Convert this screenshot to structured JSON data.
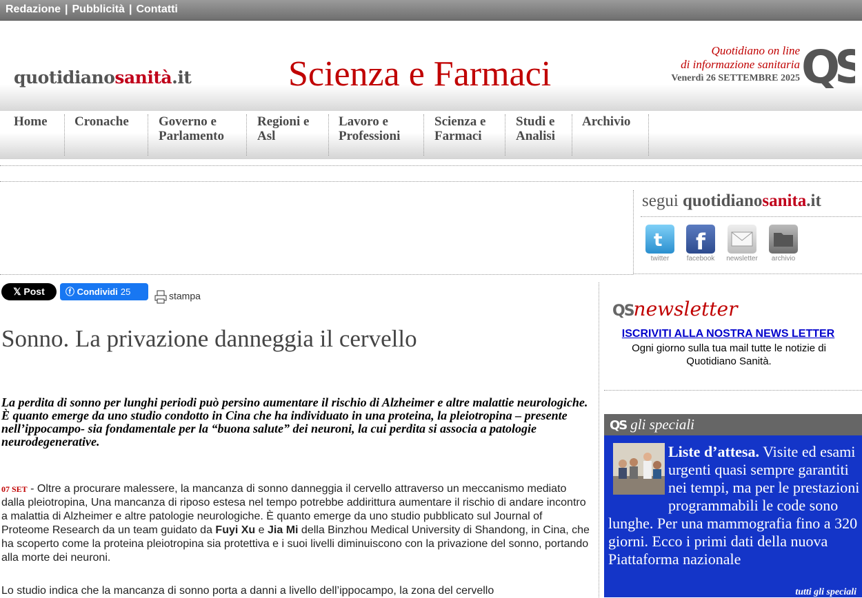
{
  "topbar": {
    "links": [
      "Redazione",
      "Pubblicità",
      "Contatti"
    ],
    "separator": "|"
  },
  "header": {
    "logo_part1": "quotidiano",
    "logo_part2": "sanità",
    "logo_part3": ".it",
    "section_title": "Scienza e Farmaci",
    "tagline_line1": "Quotidiano on line",
    "tagline_line2": "di informazione sanitaria",
    "date": "Venerdì 26 SETTEMBRE 2025",
    "brand_mark": "QS"
  },
  "nav": {
    "items": [
      {
        "line1": "Home",
        "line2": ""
      },
      {
        "line1": "Cronache",
        "line2": ""
      },
      {
        "line1": "Governo e",
        "line2": "Parlamento"
      },
      {
        "line1": "Regioni e",
        "line2": "Asl"
      },
      {
        "line1": "Lavoro e",
        "line2": "Professioni"
      },
      {
        "line1": "Scienza e",
        "line2": "Farmaci"
      },
      {
        "line1": "Studi e",
        "line2": "Analisi"
      },
      {
        "line1": "Archivio",
        "line2": ""
      }
    ]
  },
  "follow": {
    "prefix": "segui ",
    "name1": "quotidiano",
    "name2": "sanita",
    "name3": ".it",
    "channels": [
      {
        "label": "twitter",
        "icon": "twitter-icon",
        "color": "#3aa6e0"
      },
      {
        "label": "facebook",
        "icon": "facebook-icon",
        "color": "#3b5998"
      },
      {
        "label": "newsletter",
        "icon": "envelope-icon",
        "color": "#c8c8c8"
      },
      {
        "label": "archivio",
        "icon": "folder-icon",
        "color": "#8a8a8a"
      }
    ]
  },
  "share": {
    "x_post": "Post",
    "fb_label": "Condividi",
    "fb_count": "25",
    "print_label": "stampa"
  },
  "article": {
    "title": "Sonno. La privazione danneggia il cervello",
    "lead": "La perdita di sonno per lunghi periodi può persino aumentare il rischio di Alzheimer e altre malattie neurologiche. È quanto emerge da uno studio condotto in Cina che ha individuato in una proteina, la pleiotropina – presente nell’ippocampo- sia fondamentale per la “buona salute” dei neuroni, la cui perdita si associa a patologie neurodegenerative.",
    "dateline": "07 SET",
    "p1_a": " - Oltre a procurare malessere, la mancanza di sonno danneggia il cervello attraverso un meccanismo mediato dalla pleiotropina, Una mancanza di riposo estesa nel tempo potrebbe addirittura aumentare il rischio di andare incontro a malattia di Alzheimer e altre patologie neurologiche. È quanto emerge da uno studio pubblicato sul Journal of Proteome Research da un team guidato da ",
    "author1": "Fuyi Xu",
    "p1_b": " e ",
    "author2": "Jia Mi",
    "p1_c": " della Binzhou Medical University di Shandong, in Cina, che ha scoperto come la proteina pleiotropina sia protettiva e i suoi livelli diminuiscono con la privazione del sonno, portando alla morte dei neuroni.",
    "p2": "Lo studio indica che la mancanza di sonno porta a danni a livello dell’ippocampo, la zona del cervello"
  },
  "newsletter": {
    "brand": "QS",
    "title": "newsletter",
    "link": "ISCRIVITI ALLA NOSTRA NEWS LETTER",
    "desc": "Ogni giorno sulla tua mail tutte le notizie di Quotidiano Sanità."
  },
  "specials": {
    "brand": "QS",
    "title": "gli speciali",
    "headline_bold": "Liste d’attesa.",
    "headline_rest": " Visite ed esami urgenti quasi sempre garantiti nei tempi, ma per le prestazioni programmabili le code sono lunghe. Per una mammografia fino a 320 giorni. Ecco i primi dati della nuova Piattaforma nazionale",
    "more": "tutti gli speciali"
  }
}
